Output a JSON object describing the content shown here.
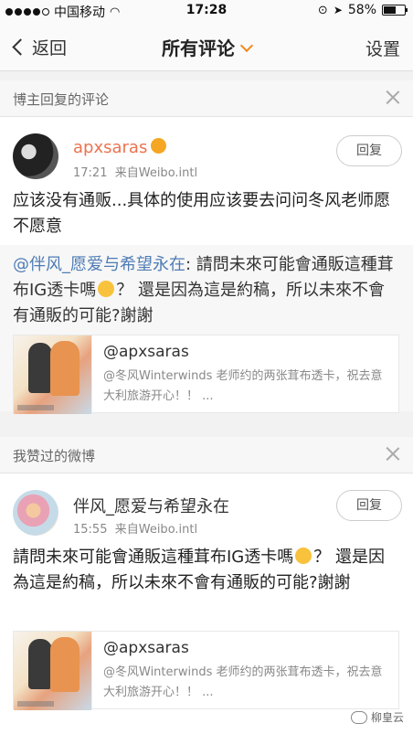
{
  "status_bar": {
    "carrier": "中国移动",
    "time": "17:28",
    "battery_text": "58%",
    "battery_level": 0.58,
    "signal_filled": 4,
    "signal_total": 5
  },
  "nav": {
    "back_label": "返回",
    "title": "所有评论",
    "settings_label": "设置"
  },
  "section1": {
    "label": "博主回复的评论",
    "comment": {
      "username": "apxsaras",
      "time": "17:21",
      "source": "来自Weibo.intl",
      "reply_label": "回复",
      "text": "应该没有通贩...具体的使用应该要去问问冬风老师愿不愿意"
    },
    "quote": {
      "mention": "@伴风_愿爱与希望永在",
      "text_a": ": 請問未來可能會通販這種茸布IG透卡嗎",
      "text_b": "？ 還是因為這是約稿，所以未來不會有通販的可能?謝謝"
    },
    "share": {
      "title": "@apxsaras",
      "desc": "@冬风Winterwinds 老师约的两张茸布透卡，祝去意大利旅游开心！！ ..."
    }
  },
  "section2": {
    "label": "我赞过的微博",
    "post": {
      "username": "伴风_愿爱与希望永在",
      "time": "15:55",
      "source": "来自Weibo.intl",
      "reply_label": "回复",
      "text_a": "請問未來可能會通販這種茸布IG透卡嗎",
      "text_b": "？ 還是因為這是約稿，所以未來不會有通販的可能?謝謝"
    },
    "share": {
      "title": "@apxsaras",
      "desc": "@冬风Winterwinds 老师约的两张茸布透卡，祝去意大利旅游开心！！ ..."
    }
  },
  "watermark": "柳皇云"
}
